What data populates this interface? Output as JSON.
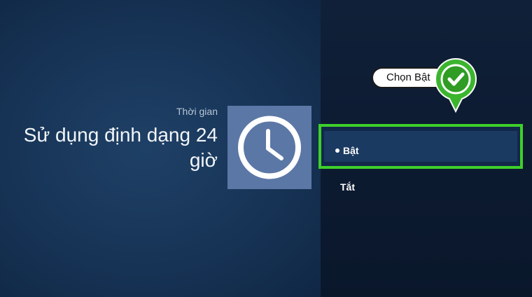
{
  "screen": {
    "category": "Thời gian",
    "setting_title": "Sử dụng định dạng 24 giờ",
    "icon": "clock-icon"
  },
  "options": [
    {
      "label": "Bật",
      "selected": true
    },
    {
      "label": "Tắt",
      "selected": false
    }
  ],
  "annotation": {
    "callout_text": "Chọn Bật",
    "badge_icon": "checkmark-icon"
  },
  "colors": {
    "highlight_border": "#3ecf2a",
    "icon_tile": "#5b77a6",
    "badge": "#3bb52e"
  }
}
